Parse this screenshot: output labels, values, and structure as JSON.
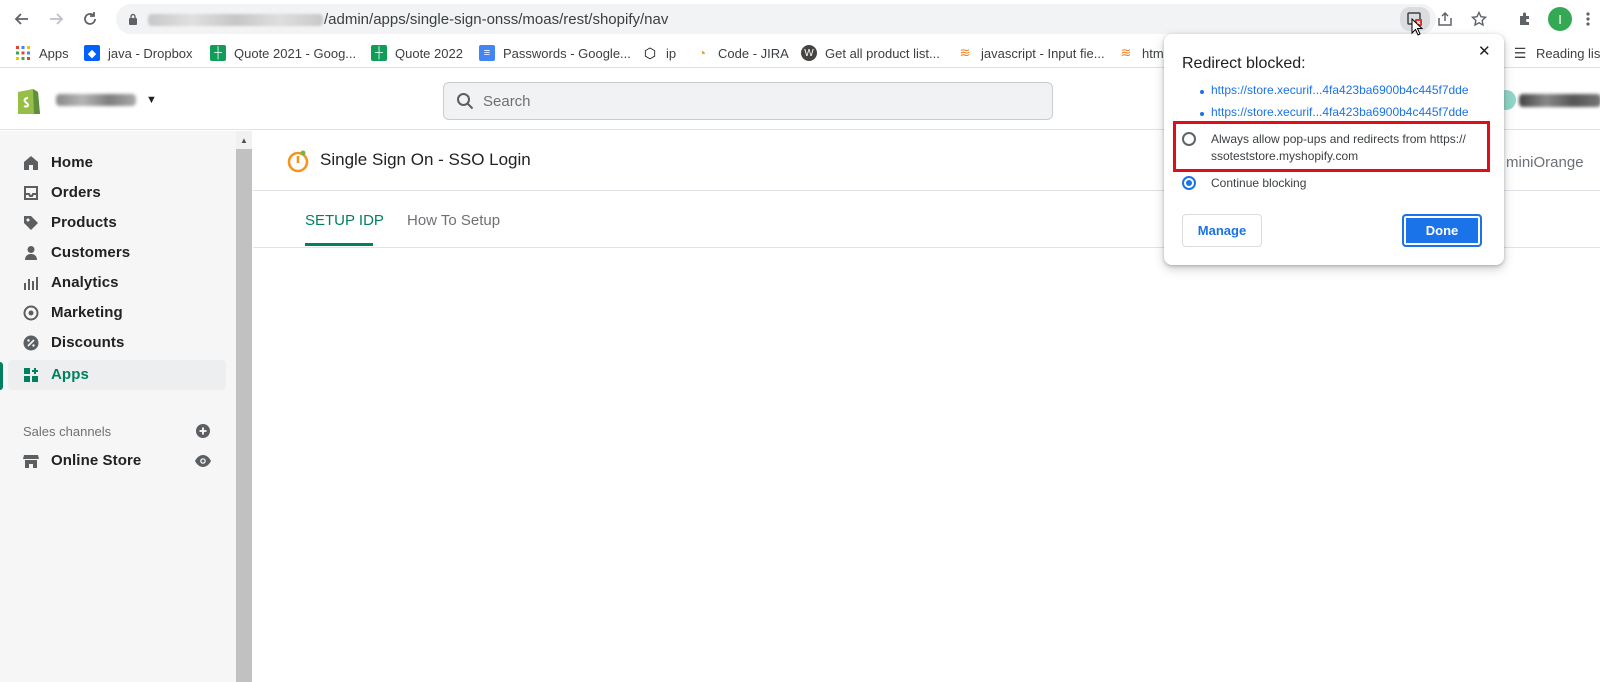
{
  "browser": {
    "url_path": "/admin/apps/single-sign-onss/moas/rest/shopify/nav",
    "profile_initial": "I",
    "reading_list_label": "Reading list"
  },
  "bookmarks": [
    {
      "label": "Apps",
      "icon": "apps-grid-icon"
    },
    {
      "label": "java - Dropbox",
      "icon": "dropbox-icon"
    },
    {
      "label": "Quote 2021 - Goog...",
      "icon": "sheets-icon"
    },
    {
      "label": "Quote 2022",
      "icon": "sheets-icon"
    },
    {
      "label": "Passwords - Google...",
      "icon": "docs-icon"
    },
    {
      "label": "ip",
      "icon": "codepen-icon"
    },
    {
      "label": "Code - JIRA",
      "icon": "jira-icon"
    },
    {
      "label": "Get all product list...",
      "icon": "wordpress-icon"
    },
    {
      "label": "javascript - Input fie...",
      "icon": "stackoverflow-icon"
    },
    {
      "label": "htm",
      "icon": "stackoverflow-icon"
    }
  ],
  "shopify": {
    "search_placeholder": "Search",
    "nav": [
      {
        "label": "Home",
        "icon": "home-icon"
      },
      {
        "label": "Orders",
        "icon": "orders-icon"
      },
      {
        "label": "Products",
        "icon": "tag-icon"
      },
      {
        "label": "Customers",
        "icon": "person-icon"
      },
      {
        "label": "Analytics",
        "icon": "bar-chart-icon"
      },
      {
        "label": "Marketing",
        "icon": "target-icon"
      },
      {
        "label": "Discounts",
        "icon": "discount-icon"
      },
      {
        "label": "Apps",
        "icon": "apps-icon"
      }
    ],
    "sales_channels_title": "Sales channels",
    "online_store_label": "Online Store"
  },
  "app": {
    "title": "Single Sign On - SSO Login",
    "vendor": "miniOrange",
    "tabs": [
      "SETUP IDP",
      "How To Setup"
    ]
  },
  "popup": {
    "title": "Redirect blocked:",
    "links": [
      "https://store.xecurif...4fa423ba6900b4c445f7dde",
      "https://store.xecurif...4fa423ba6900b4c445f7dde"
    ],
    "option_allow_line1": "Always allow pop-ups and redirects from https://",
    "option_allow_line2": "ssoteststore.myshopify.com",
    "option_block": "Continue blocking",
    "manage_label": "Manage",
    "done_label": "Done",
    "close_glyph": "✕"
  },
  "colors": {
    "shopify_green": "#008060",
    "chrome_blue": "#1a73e8",
    "highlight_red": "#e00d1a"
  }
}
